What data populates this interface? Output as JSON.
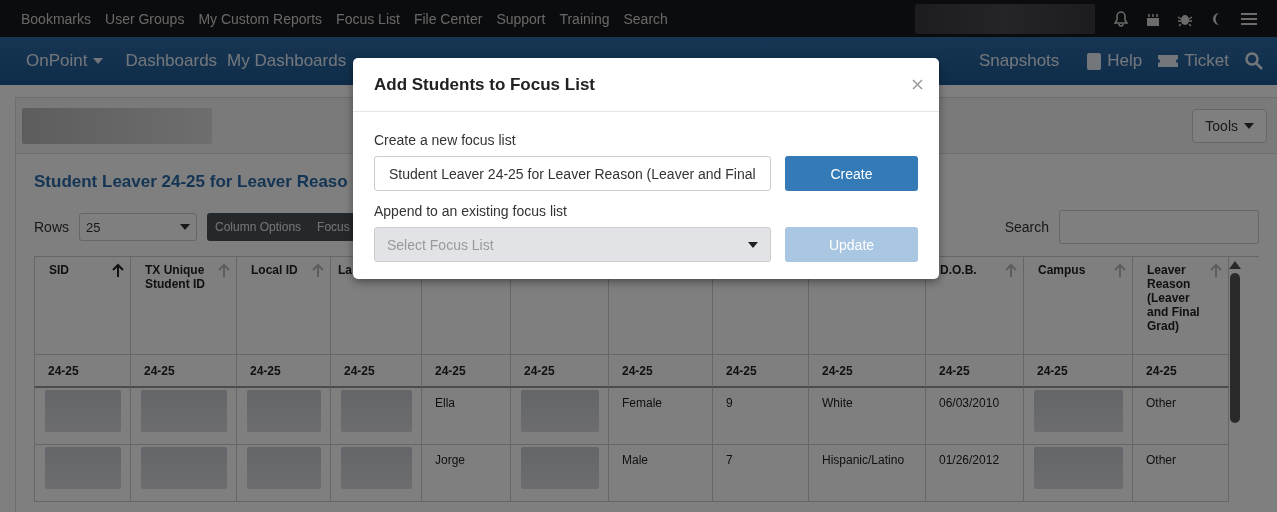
{
  "top_bar": {
    "links": [
      "Bookmarks",
      "User Groups",
      "My Custom Reports",
      "Focus List",
      "File Center",
      "Support",
      "Training",
      "Search"
    ]
  },
  "nav": {
    "brand": "OnPoint",
    "items": [
      "Dashboards",
      "My Dashboards"
    ],
    "right_items": [
      "Snapshots"
    ],
    "actions": [
      "Help",
      "Ticket"
    ]
  },
  "report": {
    "title": "Student Leaver 24-25 for Leaver Reaso",
    "tools_button": "Tools",
    "rows_label": "Rows",
    "rows_value": "25",
    "toolbar_buttons": [
      "Column Options",
      "Focus"
    ],
    "search_label": "Search"
  },
  "table": {
    "columns": [
      {
        "kind": "header",
        "label": "SID",
        "sorted": true
      },
      {
        "kind": "header",
        "label": "TX Unique Student ID",
        "sorted": false
      },
      {
        "kind": "header",
        "label": "Local ID",
        "sorted": false
      },
      {
        "kind": "partial",
        "label": "La"
      },
      {
        "kind": "covered"
      },
      {
        "kind": "covered"
      },
      {
        "kind": "covered"
      },
      {
        "kind": "covered"
      },
      {
        "kind": "covered"
      },
      {
        "kind": "header",
        "label": "D.O.B.",
        "sorted": false
      },
      {
        "kind": "header",
        "label": "Campus",
        "sorted": false
      },
      {
        "kind": "header",
        "label": "Leaver Reason (Leaver and Final Grad)",
        "sorted": false
      }
    ],
    "year_row": [
      "24-25",
      "24-25",
      "24-25",
      "24-25",
      "24-25",
      "24-25",
      "24-25",
      "24-25",
      "24-25",
      "24-25",
      "24-25",
      "24-25"
    ],
    "rows": [
      {
        "cells": [
          {
            "kind": "redacted"
          },
          {
            "kind": "redacted"
          },
          {
            "kind": "redacted"
          },
          {
            "kind": "redacted"
          },
          {
            "kind": "text",
            "text": "Ella"
          },
          {
            "kind": "redacted"
          },
          {
            "kind": "text",
            "text": "Female"
          },
          {
            "kind": "text",
            "text": "9"
          },
          {
            "kind": "text",
            "text": "White"
          },
          {
            "kind": "text",
            "text": "06/03/2010"
          },
          {
            "kind": "redacted"
          },
          {
            "kind": "text",
            "text": "Other"
          }
        ]
      },
      {
        "cells": [
          {
            "kind": "redacted"
          },
          {
            "kind": "redacted"
          },
          {
            "kind": "redacted"
          },
          {
            "kind": "redacted"
          },
          {
            "kind": "text",
            "text": "Jorge"
          },
          {
            "kind": "redacted"
          },
          {
            "kind": "text",
            "text": "Male"
          },
          {
            "kind": "text",
            "text": "7"
          },
          {
            "kind": "text",
            "text": "Hispanic/Latino"
          },
          {
            "kind": "text",
            "text": "01/26/2012"
          },
          {
            "kind": "redacted"
          },
          {
            "kind": "text",
            "text": "Other"
          }
        ]
      }
    ]
  },
  "modal": {
    "title": "Add Students to Focus List",
    "create_label": "Create a new focus list",
    "create_value": "Student Leaver 24-25 for Leaver Reason (Leaver and Final",
    "create_button": "Create",
    "append_label": "Append to an existing focus list",
    "select_placeholder": "Select Focus List",
    "select_disabled": true,
    "update_button": "Update",
    "update_disabled": true
  }
}
